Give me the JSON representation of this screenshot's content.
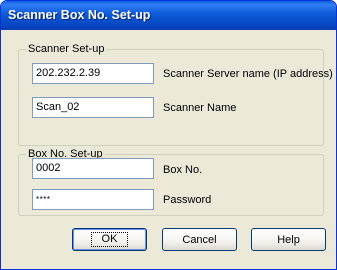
{
  "window": {
    "title": "Scanner Box No. Set-up"
  },
  "scanner_group": {
    "legend": "Scanner Set-up",
    "server_value": "202.232.2.39",
    "server_label": "Scanner Server name (IP address)",
    "name_value": "Scan_02",
    "name_label": "Scanner Name"
  },
  "box_group": {
    "legend": "Box No. Set-up",
    "box_value": "0002",
    "box_label": "Box No.",
    "password_value": "****",
    "password_label": "Password"
  },
  "buttons": {
    "ok": "OK",
    "cancel": "Cancel",
    "help": "Help"
  }
}
